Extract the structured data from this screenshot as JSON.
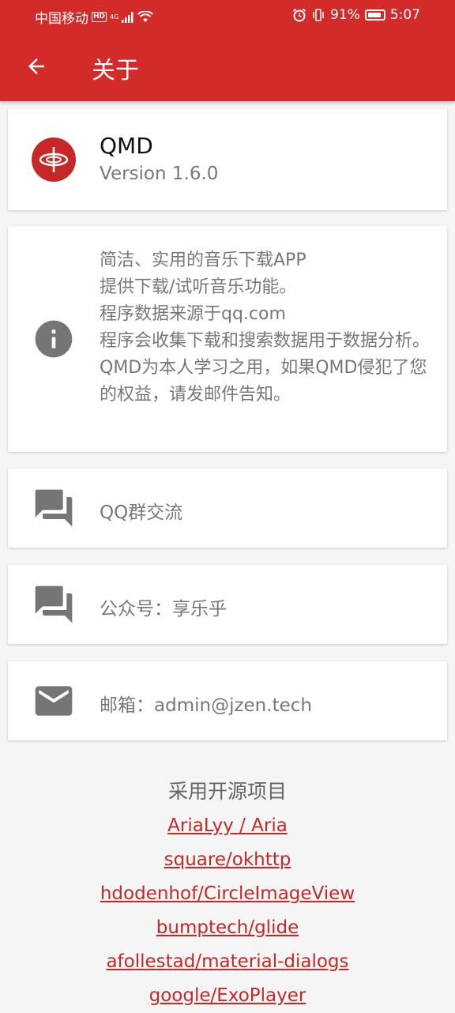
{
  "status_bar": {
    "carrier": "中国移动",
    "hd": "HD",
    "network": "4G",
    "battery": "91%",
    "time": "5:07"
  },
  "toolbar": {
    "title": "关于"
  },
  "app_card": {
    "name": "QMD",
    "version": "Version 1.6.0"
  },
  "description": {
    "lines": [
      "简洁、实用的音乐下载APP",
      "提供下载/试听音乐功能。",
      "程序数据来源于qq.com",
      "程序会收集下载和搜索数据用于数据分析。",
      "QMD为本人学习之用，如果QMD侵犯了您的权益，请发邮件告知。"
    ]
  },
  "contacts": [
    {
      "icon": "forum-icon",
      "label": "QQ群交流"
    },
    {
      "icon": "forum-icon",
      "label": "公众号：享乐乎"
    },
    {
      "icon": "email-icon",
      "label": "邮箱：admin@jzen.tech"
    }
  ],
  "open_source": {
    "title": "采用开源项目",
    "projects": [
      "AriaLyy / Aria",
      "square/okhttp",
      "hdodenhof/CircleImageView",
      "bumptech/glide",
      "afollestad/material-dialogs",
      "google/ExoPlayer"
    ]
  },
  "colors": {
    "primary": "#d32a2a",
    "link": "#c62828",
    "icon": "#757575"
  }
}
